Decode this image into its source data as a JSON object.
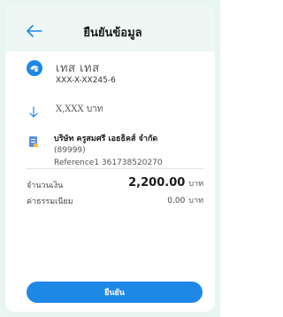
{
  "header": {
    "title": "ยืนยันข้อมูล"
  },
  "from": {
    "name": "เทส เทส",
    "account": "XXX-X-XX245-6"
  },
  "transfer": {
    "amount_masked": "X,XXX บาท"
  },
  "biller": {
    "name": "บริษัท ครูสมศรี เอธธิคส์ จำกัด",
    "code": "(89999)",
    "reference": "Reference1 361738520270"
  },
  "summary": {
    "amount_label": "จำนวนเงิน",
    "amount_value": "2,200.00",
    "amount_unit": "บาท",
    "fee_label": "ค่าธรรมเนียม",
    "fee_value": "0.00",
    "fee_unit": "บาท"
  },
  "actions": {
    "confirm_label": "ยืนยัน"
  },
  "colors": {
    "accent": "#1e88e5",
    "background": "#e9f5f1"
  }
}
